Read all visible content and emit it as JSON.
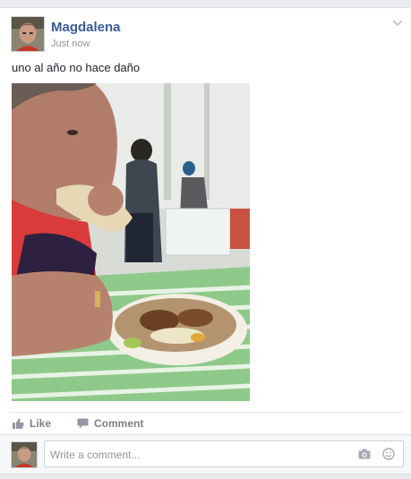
{
  "post": {
    "author": "Magdalena",
    "timestamp": "Just now",
    "text": "uno al año no hace daño",
    "photo_icon": "photo"
  },
  "actions": {
    "like_label": "Like",
    "comment_label": "Comment",
    "like_icon": "thumbs-up-icon",
    "comment_icon": "speech-bubble-icon"
  },
  "comment_input": {
    "placeholder": "Write a comment...",
    "camera_icon": "camera-icon",
    "emoji_icon": "smiley-icon"
  },
  "colors": {
    "name_link": "#3b5998",
    "secondary_text": "#90949c",
    "action_text": "#7f7f7f",
    "page_bg": "#e9ebee"
  }
}
